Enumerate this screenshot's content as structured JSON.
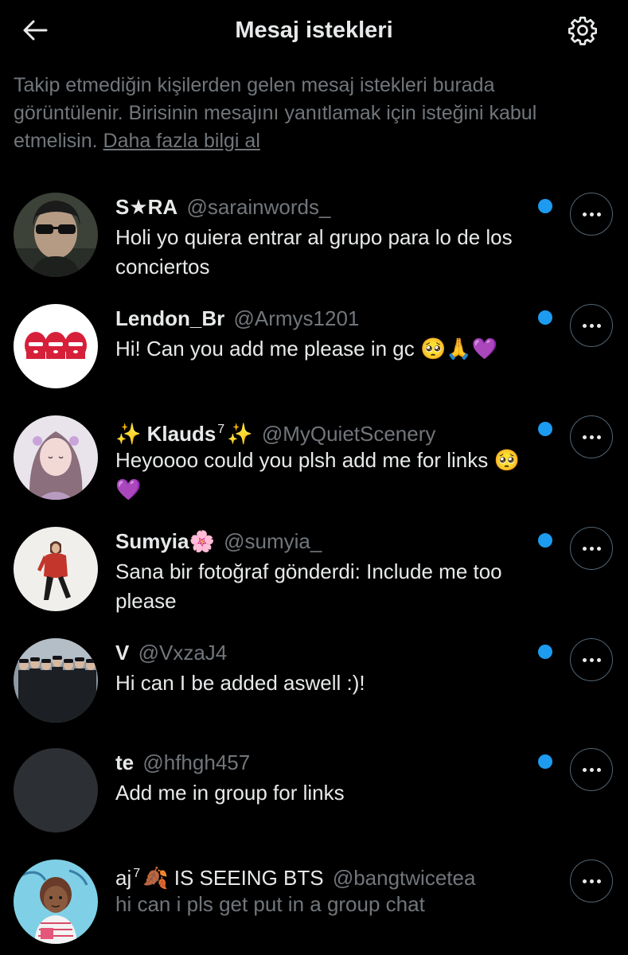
{
  "header": {
    "title": "Mesaj istekleri",
    "back_icon": "arrow-left-icon",
    "settings_icon": "gear-icon"
  },
  "intro": {
    "text": "Takip etmediğin kişilerden gelen mesaj istekleri burada görüntülenir. Birisinin mesajını yanıtlamak için isteğini kabul etmelisin.",
    "link": "Daha fazla bilgi al"
  },
  "colors": {
    "background": "#000000",
    "primary_text": "#e7e9ea",
    "secondary_text": "#71767b",
    "unread_dot": "#1d9bf0",
    "button_border": "#536471"
  },
  "requests": [
    {
      "name": "S★RA",
      "handle": "@sarainwords_",
      "message": "Holi yo quiera entrar al grupo para lo de los conciertos",
      "unread": true
    },
    {
      "name": "Lendon_Br",
      "handle": "@Armys1201",
      "message": "Hi! Can you add me please in gc 🥺🙏💜",
      "unread": true
    },
    {
      "name_prefix": "✨",
      "name": "Klauds",
      "name_sup": "7",
      "name_suffix": "✨",
      "handle": "@MyQuietScenery",
      "message": "Heyoooo could you plsh add me for links 🥺💜",
      "unread": true
    },
    {
      "name": "Sumyia",
      "name_suffix": "🌸",
      "handle": "@sumyia_",
      "message": "Sana bir fotoğraf gönderdi: Include me too please",
      "unread": true
    },
    {
      "name": "V",
      "handle": "@VxzaJ4",
      "message": "Hi can I be added aswell :)!",
      "unread": true
    },
    {
      "name": "te",
      "handle": "@hfhgh457",
      "message": "Add me in group for links",
      "unread": true
    },
    {
      "name": "aj",
      "name_sup": "7",
      "name_leaf": "🍂",
      "name_suffix": "IS SEEING BTS",
      "handle": "@bangtwicetea",
      "message": "hi can i pls get put in a group chat",
      "unread": false
    }
  ]
}
